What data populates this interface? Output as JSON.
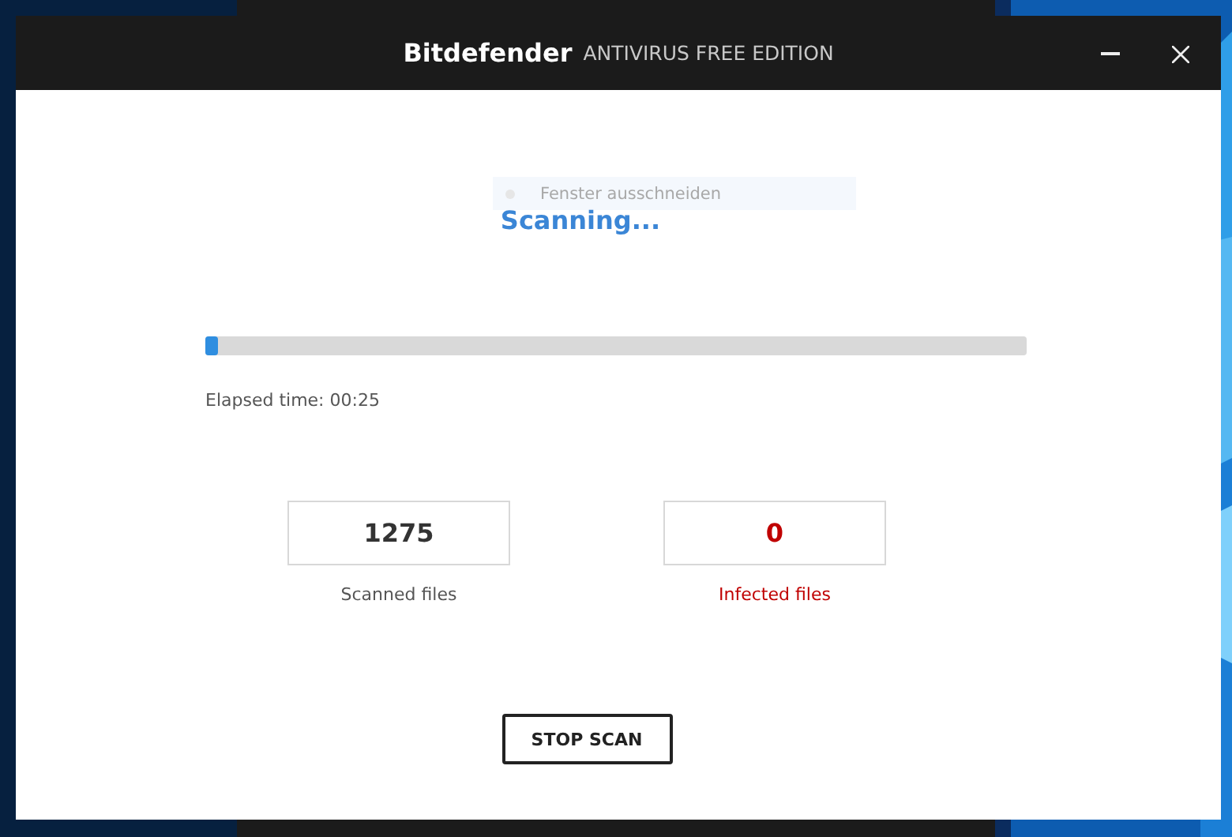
{
  "window": {
    "brand": "Bitdefender",
    "title": "ANTIVIRUS FREE EDITION"
  },
  "tooltip": {
    "label": "Fenster ausschneiden"
  },
  "status": "Scanning...",
  "progress": {
    "level": 0.015
  },
  "elapsed": "Elapsed time: 00:25",
  "counters": [
    {
      "kind": "normal",
      "value": "1275",
      "label": "Scanned files"
    },
    {
      "kind": "alert",
      "value": "0",
      "label": "Infected files"
    }
  ],
  "button": "STOP SCAN"
}
